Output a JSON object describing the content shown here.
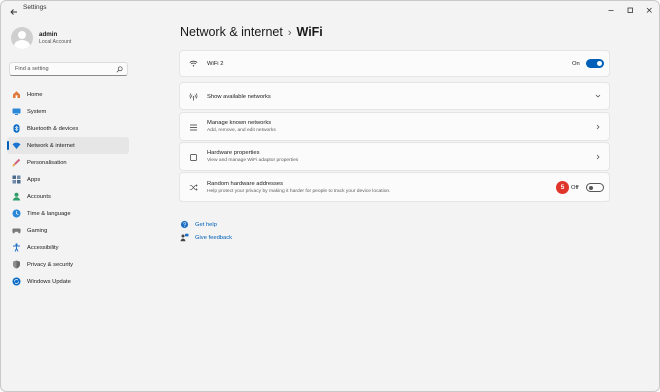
{
  "window": {
    "title": "Settings"
  },
  "profile": {
    "name": "admin",
    "account_type": "Local Account"
  },
  "search": {
    "placeholder": "Find a setting"
  },
  "sidebar": {
    "items": [
      {
        "label": "Home",
        "icon": "home-icon",
        "color": "#d86b2a"
      },
      {
        "label": "System",
        "icon": "system-icon",
        "color": "#2b88d8"
      },
      {
        "label": "Bluetooth & devices",
        "icon": "bluetooth-icon",
        "color": "#0a6cc7"
      },
      {
        "label": "Network & internet",
        "icon": "network-icon",
        "color": "#0a6cc7",
        "selected": true
      },
      {
        "label": "Personalisation",
        "icon": "personalisation-icon",
        "color": "#c0507a"
      },
      {
        "label": "Apps",
        "icon": "apps-icon",
        "color": "#3e5b7a"
      },
      {
        "label": "Accounts",
        "icon": "accounts-icon",
        "color": "#2f9e6a"
      },
      {
        "label": "Time & language",
        "icon": "time-language-icon",
        "color": "#2b88d8"
      },
      {
        "label": "Gaming",
        "icon": "gaming-icon",
        "color": "#7a7a7a"
      },
      {
        "label": "Accessibility",
        "icon": "accessibility-icon",
        "color": "#1f6fc5"
      },
      {
        "label": "Privacy & security",
        "icon": "privacy-icon",
        "color": "#6a6a6a"
      },
      {
        "label": "Windows Update",
        "icon": "windows-update-icon",
        "color": "#0a6cc7"
      }
    ]
  },
  "breadcrumb": {
    "parent": "Network & internet",
    "separator": "›",
    "current": "WiFi"
  },
  "cards": {
    "wifi": {
      "title": "WiFi 2",
      "toggle_label": "On",
      "state": "on"
    },
    "available": {
      "title": "Show available networks"
    },
    "known": {
      "title": "Manage known networks",
      "subtitle": "Add, remove, and edit networks"
    },
    "hardware": {
      "title": "Hardware properties",
      "subtitle": "View and manage WiFi adaptor properties"
    },
    "random": {
      "title": "Random hardware addresses",
      "subtitle": "Help protect your privacy by making it harder for people to track your device location.",
      "toggle_label": "Off",
      "state": "off",
      "badge": "5"
    }
  },
  "help": {
    "get_help": "Get help",
    "give_feedback": "Give feedback"
  },
  "colors": {
    "accent": "#005fb8",
    "badge": "#e0352b",
    "link": "#0060b8"
  }
}
